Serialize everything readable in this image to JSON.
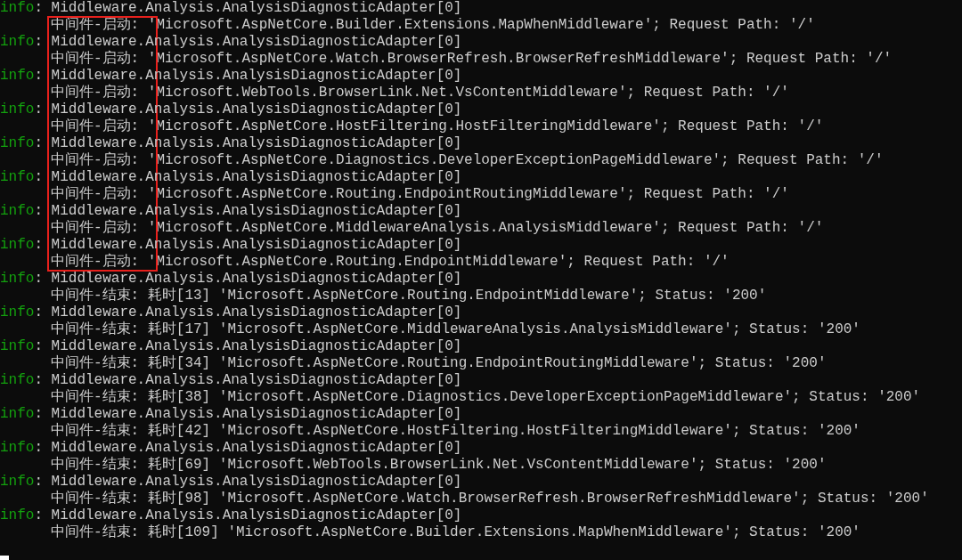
{
  "separator": ":",
  "entries": [
    {
      "level": "info",
      "source": "Middleware.Analysis.AnalysisDiagnosticAdapter[0]",
      "message": "中间件-启动: 'Microsoft.AspNetCore.Builder.Extensions.MapWhenMiddleware'; Request Path: '/'",
      "highlighted": true
    },
    {
      "level": "info",
      "source": "Middleware.Analysis.AnalysisDiagnosticAdapter[0]",
      "message": "中间件-启动: 'Microsoft.AspNetCore.Watch.BrowserRefresh.BrowserRefreshMiddleware'; Request Path: '/'",
      "highlighted": true
    },
    {
      "level": "info",
      "source": "Middleware.Analysis.AnalysisDiagnosticAdapter[0]",
      "message": "中间件-启动: 'Microsoft.WebTools.BrowserLink.Net.VsContentMiddleware'; Request Path: '/'",
      "highlighted": true
    },
    {
      "level": "info",
      "source": "Middleware.Analysis.AnalysisDiagnosticAdapter[0]",
      "message": "中间件-启动: 'Microsoft.AspNetCore.HostFiltering.HostFilteringMiddleware'; Request Path: '/'",
      "highlighted": true
    },
    {
      "level": "info",
      "source": "Middleware.Analysis.AnalysisDiagnosticAdapter[0]",
      "message": "中间件-启动: 'Microsoft.AspNetCore.Diagnostics.DeveloperExceptionPageMiddleware'; Request Path: '/'",
      "highlighted": true
    },
    {
      "level": "info",
      "source": "Middleware.Analysis.AnalysisDiagnosticAdapter[0]",
      "message": "中间件-启动: 'Microsoft.AspNetCore.Routing.EndpointRoutingMiddleware'; Request Path: '/'",
      "highlighted": true
    },
    {
      "level": "info",
      "source": "Middleware.Analysis.AnalysisDiagnosticAdapter[0]",
      "message": "中间件-启动: 'Microsoft.AspNetCore.MiddlewareAnalysis.AnalysisMiddleware'; Request Path: '/'",
      "highlighted": true
    },
    {
      "level": "info",
      "source": "Middleware.Analysis.AnalysisDiagnosticAdapter[0]",
      "message": "中间件-启动: 'Microsoft.AspNetCore.Routing.EndpointMiddleware'; Request Path: '/'",
      "highlighted": true
    },
    {
      "level": "info",
      "source": "Middleware.Analysis.AnalysisDiagnosticAdapter[0]",
      "message": "中间件-结束: 耗时[13] 'Microsoft.AspNetCore.Routing.EndpointMiddleware'; Status: '200'",
      "highlighted": false
    },
    {
      "level": "info",
      "source": "Middleware.Analysis.AnalysisDiagnosticAdapter[0]",
      "message": "中间件-结束: 耗时[17] 'Microsoft.AspNetCore.MiddlewareAnalysis.AnalysisMiddleware'; Status: '200'",
      "highlighted": false
    },
    {
      "level": "info",
      "source": "Middleware.Analysis.AnalysisDiagnosticAdapter[0]",
      "message": "中间件-结束: 耗时[34] 'Microsoft.AspNetCore.Routing.EndpointRoutingMiddleware'; Status: '200'",
      "highlighted": false
    },
    {
      "level": "info",
      "source": "Middleware.Analysis.AnalysisDiagnosticAdapter[0]",
      "message": "中间件-结束: 耗时[38] 'Microsoft.AspNetCore.Diagnostics.DeveloperExceptionPageMiddleware'; Status: '200'",
      "highlighted": false
    },
    {
      "level": "info",
      "source": "Middleware.Analysis.AnalysisDiagnosticAdapter[0]",
      "message": "中间件-结束: 耗时[42] 'Microsoft.AspNetCore.HostFiltering.HostFilteringMiddleware'; Status: '200'",
      "highlighted": false
    },
    {
      "level": "info",
      "source": "Middleware.Analysis.AnalysisDiagnosticAdapter[0]",
      "message": "中间件-结束: 耗时[69] 'Microsoft.WebTools.BrowserLink.Net.VsContentMiddleware'; Status: '200'",
      "highlighted": false
    },
    {
      "level": "info",
      "source": "Middleware.Analysis.AnalysisDiagnosticAdapter[0]",
      "message": "中间件-结束: 耗时[98] 'Microsoft.AspNetCore.Watch.BrowserRefresh.BrowserRefreshMiddleware'; Status: '200'",
      "highlighted": false
    },
    {
      "level": "info",
      "source": "Middleware.Analysis.AnalysisDiagnosticAdapter[0]",
      "message": "中间件-结束: 耗时[109] 'Microsoft.AspNetCore.Builder.Extensions.MapWhenMiddleware'; Status: '200'",
      "highlighted": false
    }
  ]
}
